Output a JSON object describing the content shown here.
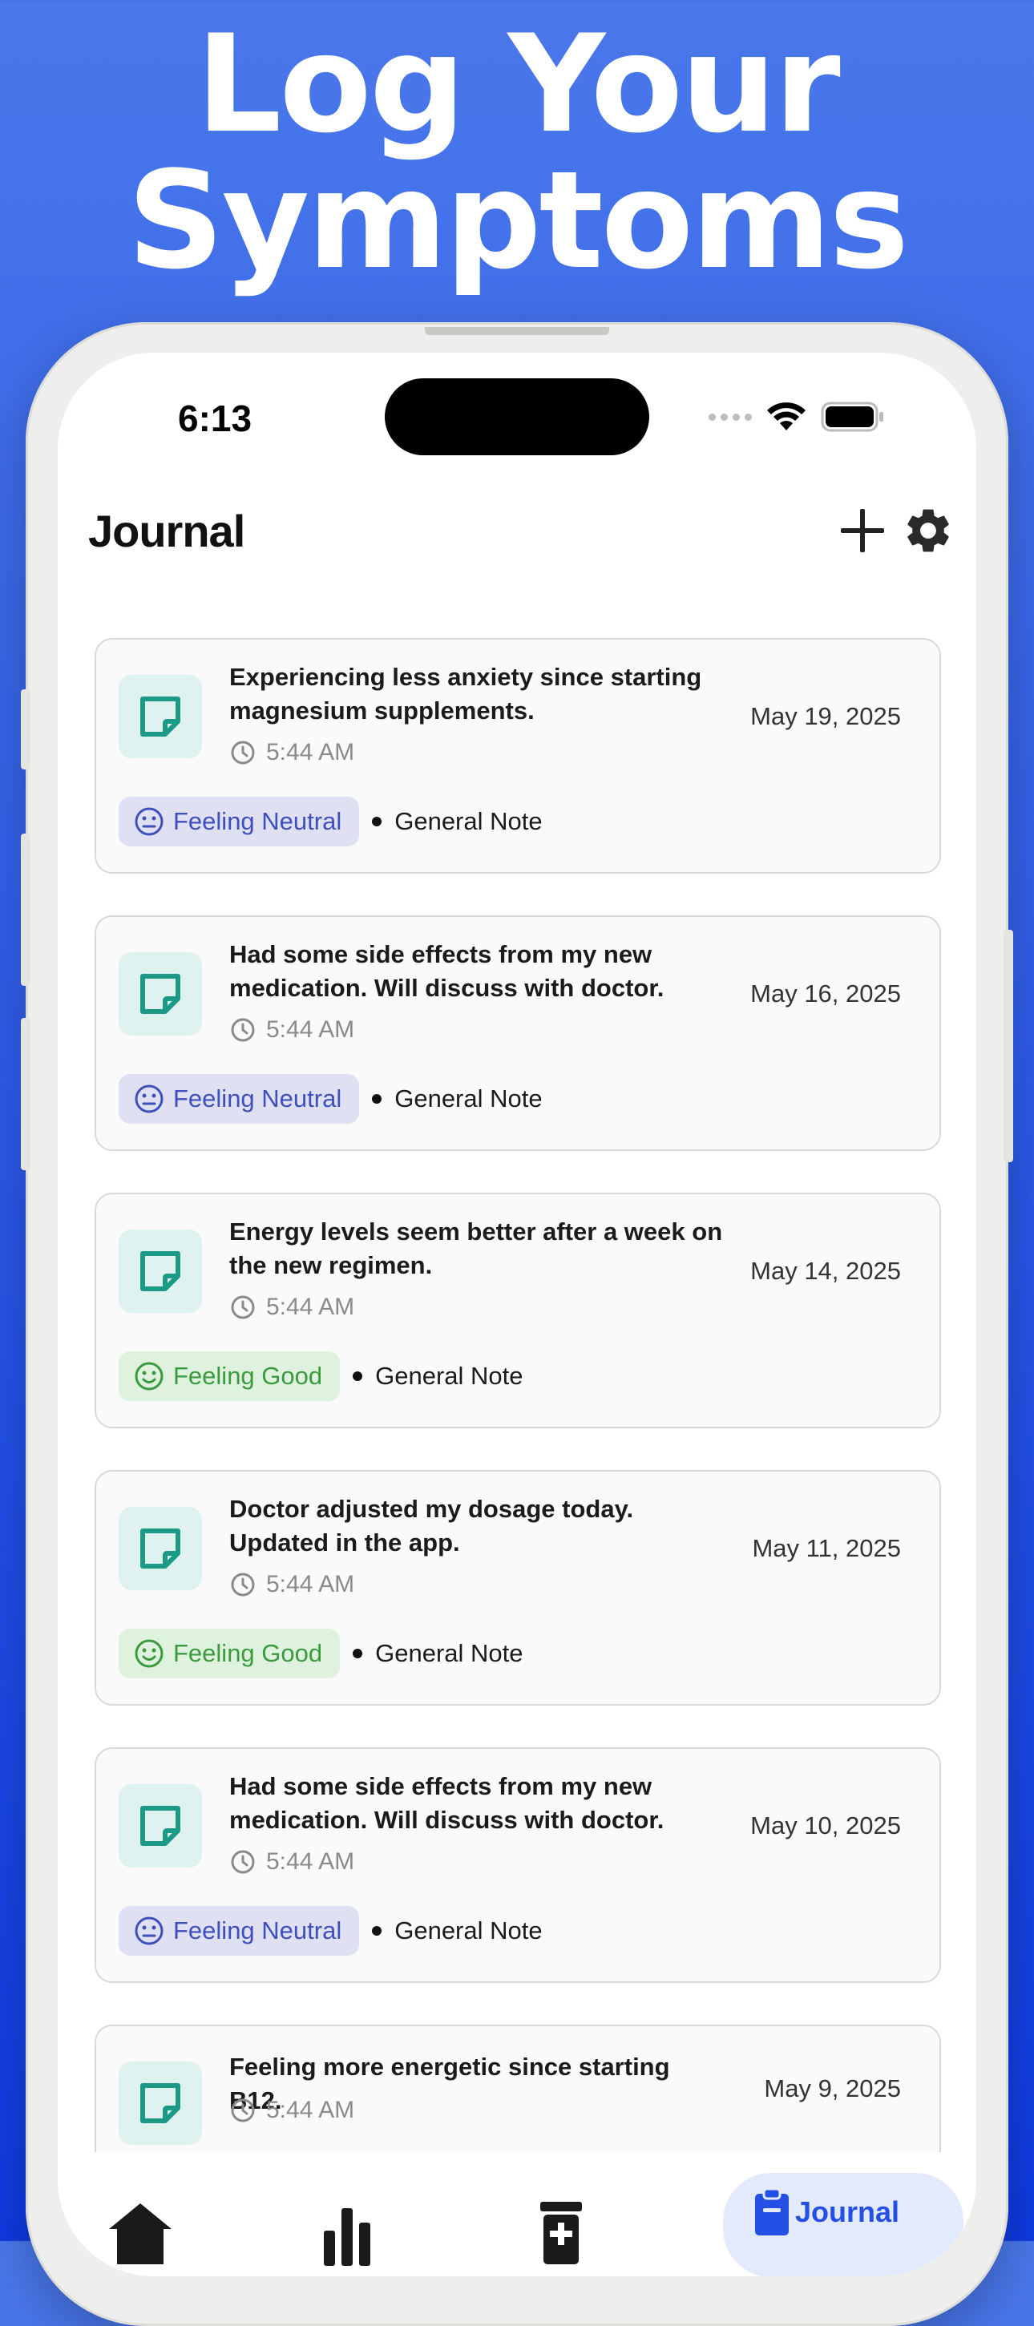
{
  "headline": {
    "line1": "Log Your",
    "line2": "Symptoms"
  },
  "status_bar": {
    "time": "6:13"
  },
  "header": {
    "title": "Journal",
    "add_icon": "plus-icon",
    "settings_icon": "gear-icon"
  },
  "colors": {
    "background": "#3563e9",
    "neutral_bg": "#dfe1f3",
    "neutral_fg": "#3f4fbb",
    "good_bg": "#dff2de",
    "good_fg": "#3a9a3f",
    "note_icon_bg": "#e0f2ef",
    "note_icon_fg": "#1a9a87",
    "accent": "#2450e6"
  },
  "entries": [
    {
      "text": "Experiencing less anxiety since starting magnesium supplements.",
      "time": "5:44 AM",
      "date": "May 19, 2025",
      "mood": "Feeling Neutral",
      "type": "General Note"
    },
    {
      "text": "Had some side effects from my new medication. Will discuss with doctor.",
      "time": "5:44 AM",
      "date": "May 16, 2025",
      "mood": "Feeling Neutral",
      "type": "General Note"
    },
    {
      "text": "Energy levels seem better after a week on the new regimen.",
      "time": "5:44 AM",
      "date": "May 14, 2025",
      "mood": "Feeling Good",
      "type": "General Note"
    },
    {
      "text": "Doctor adjusted my dosage today. Updated in the app.",
      "time": "5:44 AM",
      "date": "May 11, 2025",
      "mood": "Feeling Good",
      "type": "General Note"
    },
    {
      "text": "Had some side effects from my new medication. Will discuss with doctor.",
      "time": "5:44 AM",
      "date": "May 10, 2025",
      "mood": "Feeling Neutral",
      "type": "General Note"
    },
    {
      "text": "Feeling more energetic since starting B12.",
      "time": "5:44 AM",
      "date": "May 9, 2025",
      "mood": "",
      "type": ""
    }
  ],
  "tabbar": {
    "tabs": [
      {
        "icon": "home-icon",
        "label": ""
      },
      {
        "icon": "bar-chart-icon",
        "label": ""
      },
      {
        "icon": "medication-icon",
        "label": ""
      },
      {
        "icon": "clipboard-icon",
        "label": "Journal",
        "active": true
      }
    ]
  }
}
